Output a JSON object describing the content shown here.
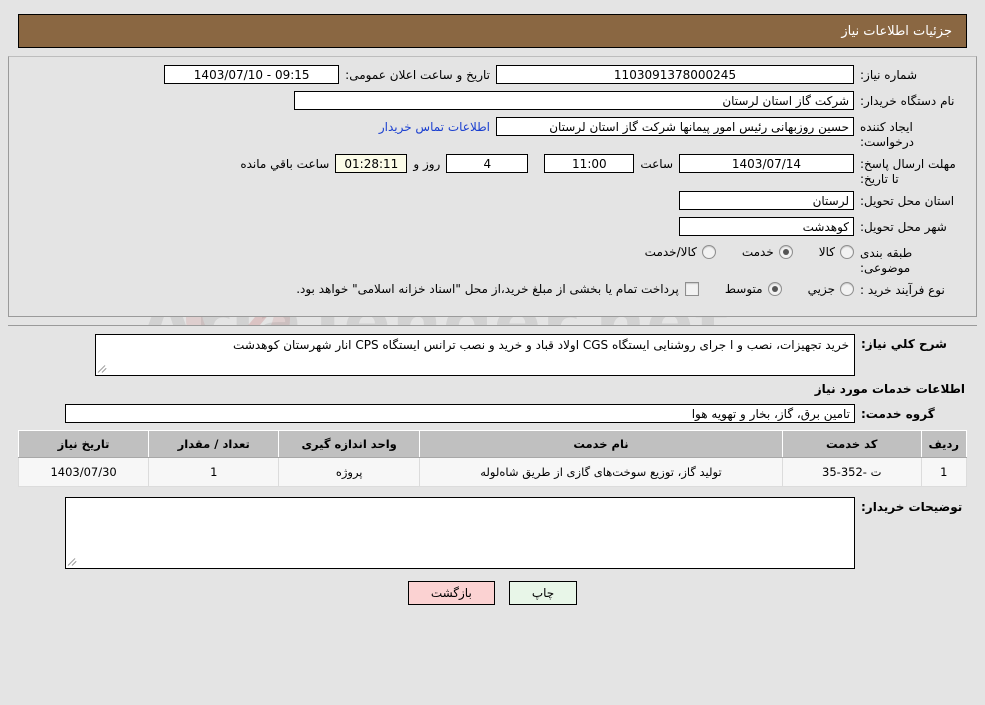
{
  "header": {
    "title": "جزئیات اطلاعات نیاز"
  },
  "fields": {
    "need_number_label": "شماره نیاز:",
    "need_number_value": "1103091378000245",
    "announce_label": "تاریخ و ساعت اعلان عمومی:",
    "announce_value": "09:15 - 1403/07/10",
    "buyer_org_label": "نام دستگاه خریدار:",
    "buyer_org_value": "شرکت گاز استان لرستان",
    "creator_label": "ایجاد کننده درخواست:",
    "creator_value": "حسین روزبهانی رئیس امور پیمانها شرکت گاز استان لرستان",
    "contact_link": "اطلاعات تماس خریدار",
    "deadline_label": "مهلت ارسال پاسخ: تا تاریخ:",
    "deadline_date": "1403/07/14",
    "hour_label": "ساعت",
    "deadline_time": "11:00",
    "days_value": "4",
    "days_label": "روز و",
    "timer_value": "01:28:11",
    "timer_label": "ساعت باقي مانده",
    "province_label": "استان محل تحویل:",
    "province_value": "لرستان",
    "city_label": "شهر محل تحویل:",
    "city_value": "کوهدشت",
    "category_label": "طبقه بندی موضوعی:",
    "process_label": "نوع فرآیند خرید :",
    "payment_note": "پرداخت تمام یا بخشی از مبلغ خرید،از محل \"اسناد خزانه اسلامی\" خواهد بود."
  },
  "category_options": [
    {
      "label": "کالا",
      "checked": false
    },
    {
      "label": "خدمت",
      "checked": true
    },
    {
      "label": "کالا/خدمت",
      "checked": false
    }
  ],
  "process_options": [
    {
      "label": "جزیي",
      "checked": false
    },
    {
      "label": "متوسط",
      "checked": true
    }
  ],
  "description": {
    "label": "شرح کلي نیاز:",
    "value": "خرید تجهیزات، نصب و ا جرای روشنایی ایستگاه CGS اولاد قباد و خرید و نصب ترانس ایستگاه CPS انار شهرستان کوهدشت"
  },
  "services_section": {
    "heading": "اطلاعات خدمات مورد نیاز",
    "group_label": "گروه خدمت:",
    "group_value": "تامین برق، گاز، بخار و تهویه هوا"
  },
  "table": {
    "headers": [
      "ردیف",
      "کد خدمت",
      "نام خدمت",
      "واحد اندازه گیری",
      "تعداد / مقدار",
      "تاریخ نیاز"
    ],
    "rows": [
      {
        "radif": "1",
        "code": "ت -352-35",
        "name": "تولید گاز، توزیع سوخت‌های گازی از طریق شاه‌لوله",
        "unit": "پروژه",
        "qty": "1",
        "date": "1403/07/30"
      }
    ]
  },
  "buyer_notes": {
    "label": "توضیحات خریدار:",
    "value": ""
  },
  "buttons": {
    "print": "چاپ",
    "return": "بازگشت"
  },
  "watermark": {
    "text": "AriaTender.net"
  }
}
